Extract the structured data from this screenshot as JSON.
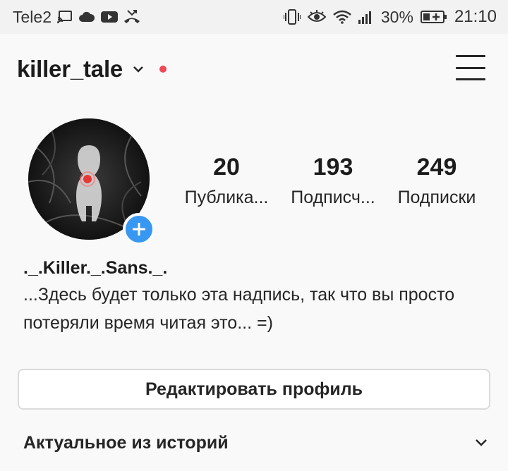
{
  "status_bar": {
    "carrier": "Tele2",
    "battery_percent": "30%",
    "time": "21:10",
    "left_icons": [
      "cast-icon",
      "cloud-icon",
      "youtube-icon",
      "missed-call-icon"
    ],
    "right_icons": [
      "vibrate-icon",
      "eye-icon",
      "wifi-icon",
      "signal-icon",
      "battery-charging-icon"
    ]
  },
  "header": {
    "username": "killer_tale",
    "dropdown_icon": "chevron-down-icon",
    "notification_dot_color": "#ed4956",
    "menu_icon": "hamburger-menu-icon"
  },
  "profile": {
    "avatar_icon": "avatar-image",
    "add_story_icon": "plus-icon",
    "stats": [
      {
        "value": "20",
        "label": "Публика..."
      },
      {
        "value": "193",
        "label": "Подписч..."
      },
      {
        "value": "249",
        "label": "Подписки"
      }
    ],
    "display_name": "._.Killer._.Sans._.",
    "bio": "...Здесь будет только эта надпись, так что вы просто потеряли время читая это... =)"
  },
  "actions": {
    "edit_profile_label": "Редактировать профиль"
  },
  "highlights": {
    "title": "Актуальное из историй",
    "toggle_icon": "chevron-down-icon"
  },
  "colors": {
    "accent_blue": "#3897f0",
    "text": "#262626",
    "background": "#fafafa"
  }
}
